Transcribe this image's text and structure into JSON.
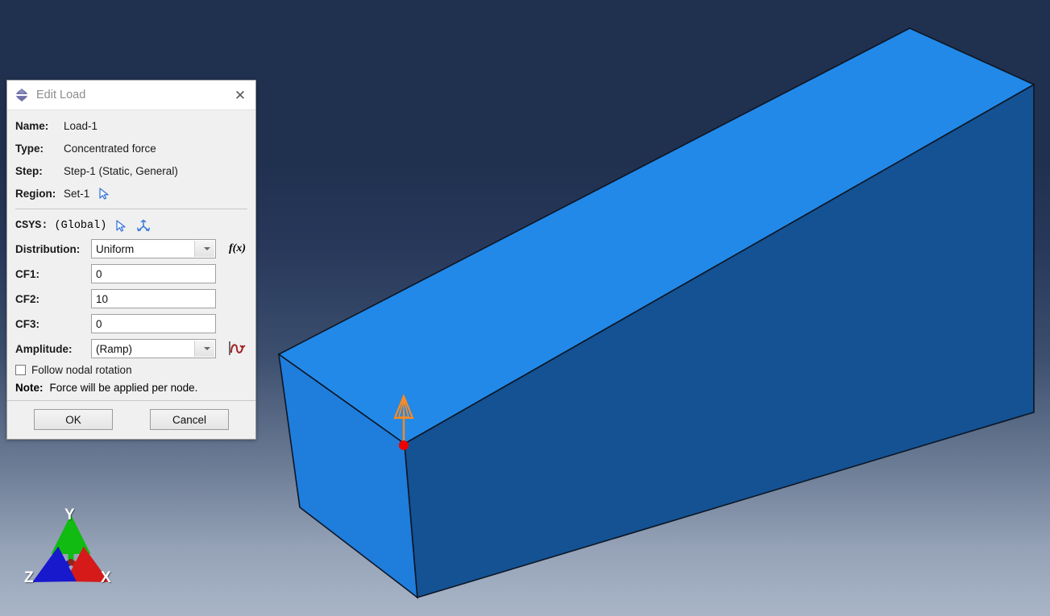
{
  "dialog": {
    "title": "Edit Load",
    "title_icon": "abaqus-diamond-icon",
    "close_icon": "close-icon",
    "fields": {
      "name_label": "Name:",
      "name_value": "Load-1",
      "type_label": "Type:",
      "type_value": "Concentrated force",
      "step_label": "Step:",
      "step_value": "Step-1 (Static, General)",
      "region_label": "Region:",
      "region_value": "Set-1",
      "region_picker_icon": "cursor-arrow-icon",
      "csys_label": "CSYS:",
      "csys_value": "(Global)",
      "csys_picker_icon": "cursor-arrow-icon",
      "csys_axes_icon": "axes-triad-icon",
      "distribution_label": "Distribution:",
      "distribution_value": "Uniform",
      "distribution_options": [
        "Uniform"
      ],
      "fx_label": "f(x)",
      "cf1_label": "CF1:",
      "cf1_value": "0",
      "cf2_label": "CF2:",
      "cf2_value": "10",
      "cf3_label": "CF3:",
      "cf3_value": "0",
      "amplitude_label": "Amplitude:",
      "amplitude_value": "(Ramp)",
      "amplitude_options": [
        "(Ramp)"
      ],
      "amplitude_icon": "amplitude-wave-icon",
      "follow_checkbox_label": "Follow nodal rotation",
      "follow_checkbox_checked": false,
      "note_label": "Note:",
      "note_text": "Force will be applied per node."
    },
    "buttons": {
      "ok": "OK",
      "cancel": "Cancel"
    }
  },
  "viewport": {
    "triad": {
      "x_label": "X",
      "y_label": "Y",
      "z_label": "Z",
      "x_color": "#d61a1a",
      "y_color": "#11bb11",
      "z_color": "#1818cc"
    },
    "load_marker": {
      "arrow_color": "#ff8a1e",
      "node_color": "#ee0000"
    },
    "colors": {
      "background_top": "#20304f",
      "background_bottom": "#a9b5c7",
      "beam_top_face": "#2289e8",
      "beam_end_face": "#1f7ddc",
      "beam_side_face": "#145293",
      "beam_edge": "#0d1624"
    }
  }
}
